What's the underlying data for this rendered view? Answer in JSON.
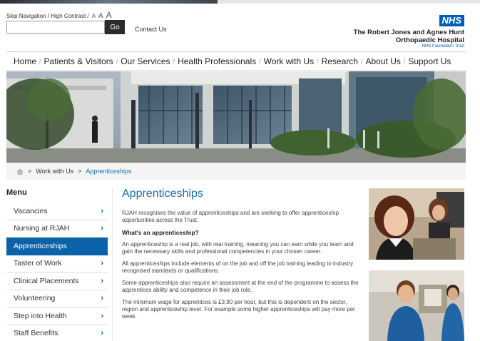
{
  "utility": {
    "skip_label": "Skip Navigation / High Contrast /",
    "text_size_small": "A",
    "text_size_medium": "A",
    "text_size_large": "A"
  },
  "search": {
    "value": "",
    "placeholder": "",
    "go_label": "Go"
  },
  "contact_label": "Contact Us",
  "logo": {
    "badge": "NHS",
    "line1": "The Robert Jones and Agnes Hunt",
    "line2": "Orthopaedic Hospital",
    "line3": "NHS Foundation Trust"
  },
  "nav": {
    "items": [
      "Home",
      "Patients & Visitors",
      "Our Services",
      "Health Professionals",
      "Work with Us",
      "Research",
      "About Us",
      "Support Us"
    ],
    "separator": "/"
  },
  "breadcrumb": {
    "separator": ">",
    "parent": "Work with Us",
    "current": "Apprenticeships"
  },
  "menu": {
    "title": "Menu",
    "items": [
      {
        "label": "Vacancies"
      },
      {
        "label": "Nursing at RJAH"
      },
      {
        "label": "Apprenticeships",
        "active": true
      },
      {
        "label": "Taster of Work"
      },
      {
        "label": "Clinical Placements"
      },
      {
        "label": "Volunteering"
      },
      {
        "label": "Step into Health"
      },
      {
        "label": "Staff Benefits"
      }
    ]
  },
  "content": {
    "title": "Apprenticeships",
    "intro": "RJAH recognises the value of apprenticeships and are seeking to offer apprenticeship opportunities across the Trust.",
    "subheading": "What's an apprenticeship?",
    "p1": "An apprenticeship is a real job, with real training, meaning you can earn while you learn and gain the necessary skills and professional competencies in your chosen career.",
    "p2": "All apprenticeships include elements of on the job and off the job training leading to industry recognised standards or qualifications.",
    "p3": "Some apprenticeships also require an assessment at the end of the programme to assess the apprentices ability and competence in their job role.",
    "p4": "The minimum wage for apprentices is £3.90 per hour, but this is dependent on the sector, region and apprenticeship level. For example some higher apprenticeships will pay more per week."
  },
  "colors": {
    "brand_blue": "#005eb8",
    "active_menu": "#0b62a8",
    "heading_blue": "#1a6fb0"
  }
}
